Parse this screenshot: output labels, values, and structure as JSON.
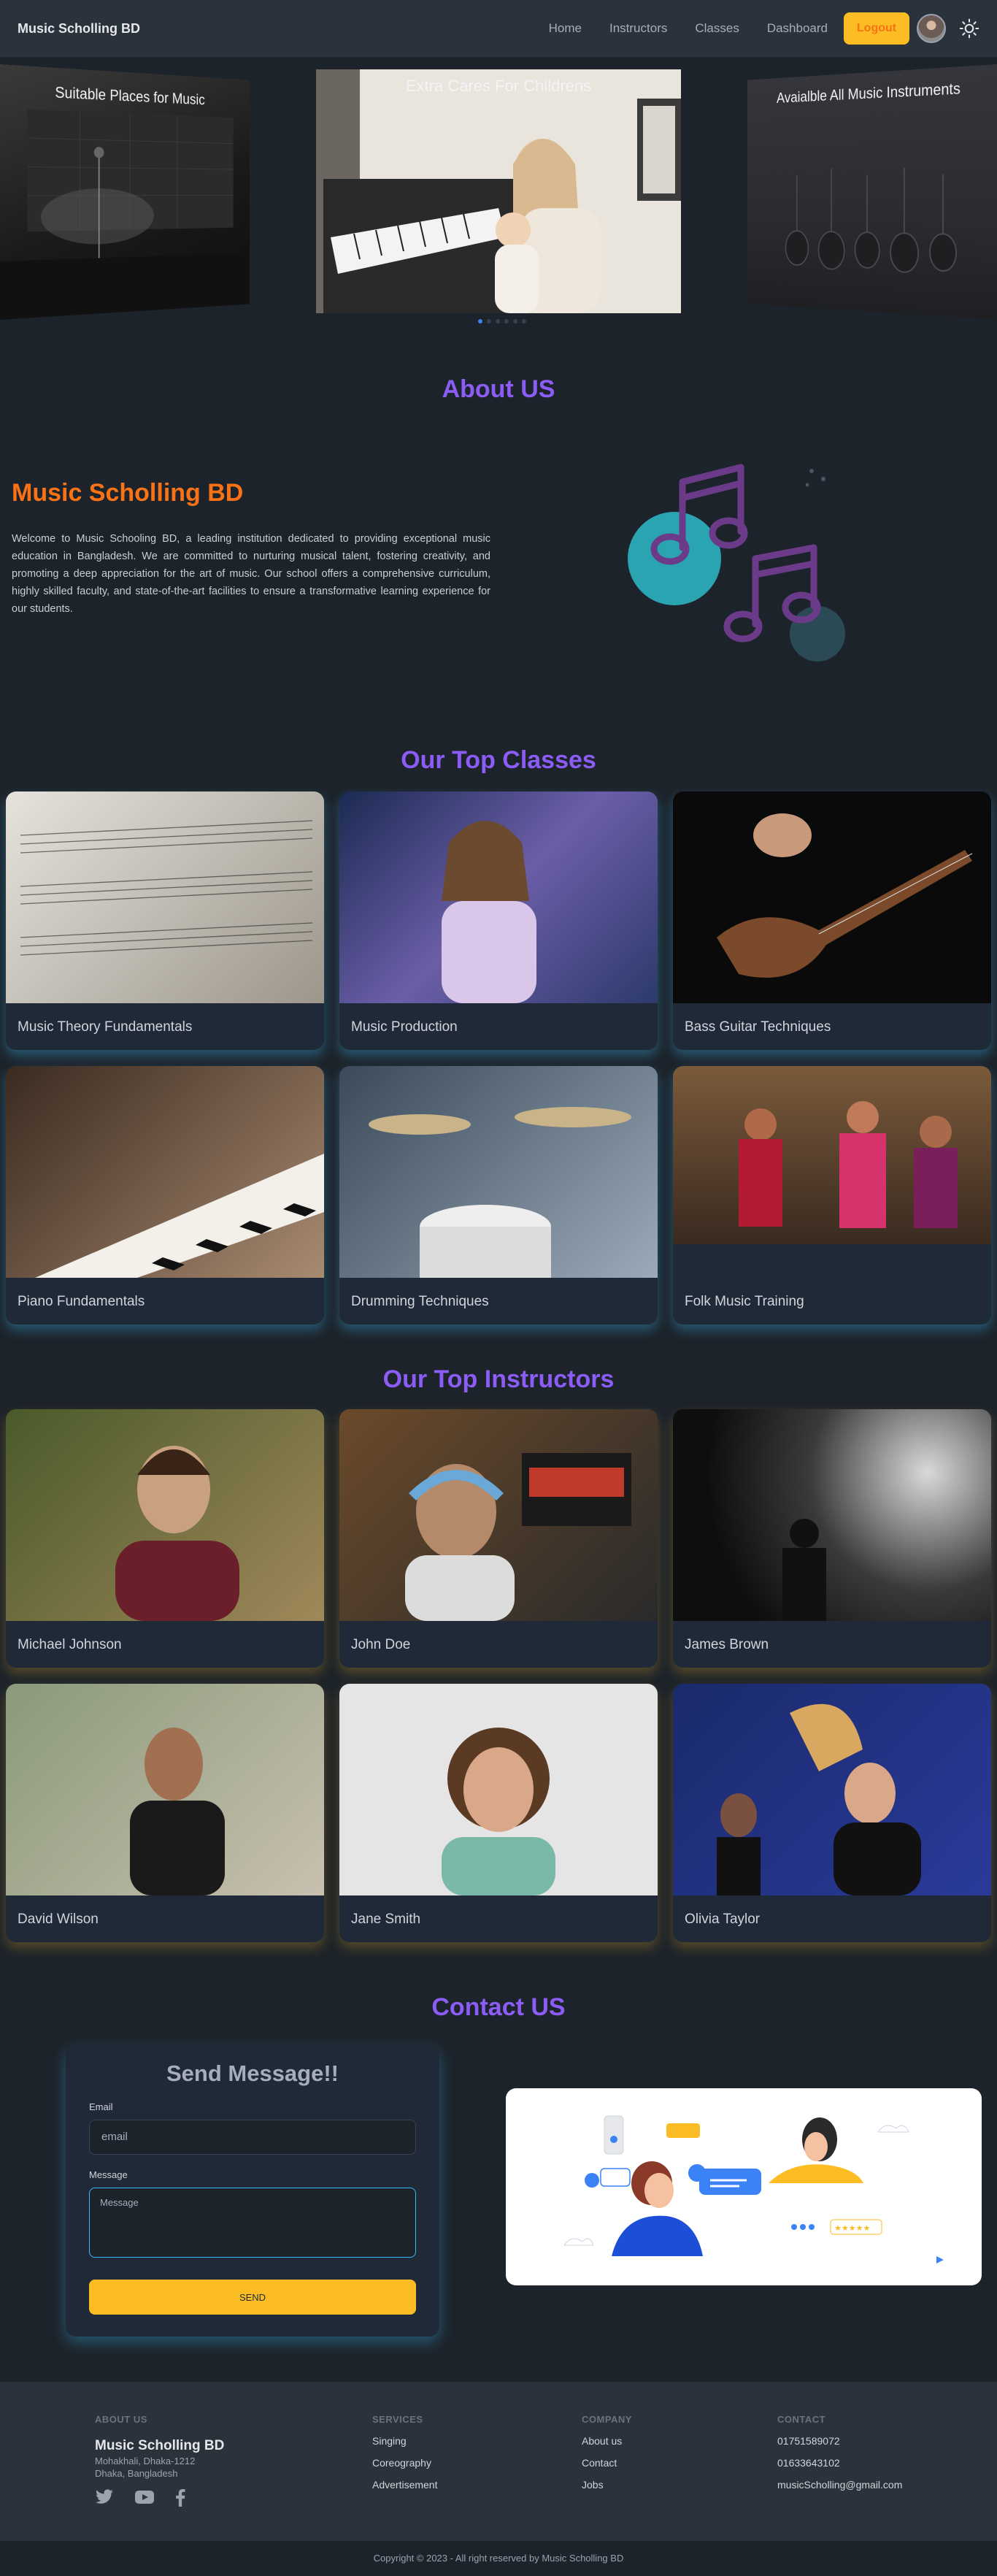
{
  "navbar": {
    "brand": "Music Scholling BD",
    "links": [
      "Home",
      "Instructors",
      "Classes",
      "Dashboard"
    ],
    "logout_label": "Logout",
    "avatar_icon": "user-avatar",
    "theme_icon": "sun-icon"
  },
  "carousel": {
    "slides": [
      {
        "title": "Suitable Places for Music"
      },
      {
        "title": "Extra Cares For Childrens"
      },
      {
        "title": "Avaialble All Music Instruments"
      }
    ],
    "active_index": 0
  },
  "about": {
    "section_title": "About US",
    "heading": "Music Scholling BD",
    "text": "Welcome to Music Schooling BD, a leading institution dedicated to providing exceptional music education in Bangladesh. We are committed to nurturing musical talent, fostering creativity, and promoting a deep appreciation for the art of music. Our school offers a comprehensive curriculum, highly skilled faculty, and state-of-the-art facilities to ensure a transformative learning experience for our students."
  },
  "classes": {
    "section_title": "Our Top Classes",
    "items": [
      {
        "title": "Music Theory Fundamentals"
      },
      {
        "title": "Music Production"
      },
      {
        "title": "Bass Guitar Techniques"
      },
      {
        "title": "Piano Fundamentals"
      },
      {
        "title": "Drumming Techniques"
      },
      {
        "title": "Folk Music Training"
      }
    ]
  },
  "instructors": {
    "section_title": "Our Top Instructors",
    "items": [
      {
        "name": "Michael Johnson"
      },
      {
        "name": "John Doe"
      },
      {
        "name": "James Brown"
      },
      {
        "name": "David Wilson"
      },
      {
        "name": "Jane Smith"
      },
      {
        "name": "Olivia Taylor"
      }
    ]
  },
  "contact": {
    "section_title": "Contact US",
    "form_title": "Send Message!!",
    "email_label": "Email",
    "email_placeholder": "email",
    "message_label": "Message",
    "message_placeholder": "Message",
    "send_label": "SEND"
  },
  "footer": {
    "about_title": "ABOUT US",
    "brand": "Music Scholling BD",
    "address_line1": "Mohakhali, Dhaka-1212",
    "address_line2": "Dhaka, Bangladesh",
    "social_icons": [
      "twitter-icon",
      "youtube-icon",
      "facebook-icon"
    ],
    "services_title": "SERVICES",
    "services": [
      "Singing",
      "Coreography",
      "Advertisement"
    ],
    "company_title": "COMPANY",
    "company": [
      "About us",
      "Contact",
      "Jobs"
    ],
    "contact_title": "CONTACT",
    "phone1": "01751589072",
    "phone2": "01633643102",
    "email": "musicScholling@gmail.com",
    "copyright": "Copyright © 2023 - All right reserved by Music Scholling BD"
  },
  "colors": {
    "accent_purple": "#8b5cf6",
    "accent_orange": "#f97316",
    "accent_yellow": "#fbbd23",
    "background": "#1d232a",
    "navbar": "#2a323c"
  }
}
